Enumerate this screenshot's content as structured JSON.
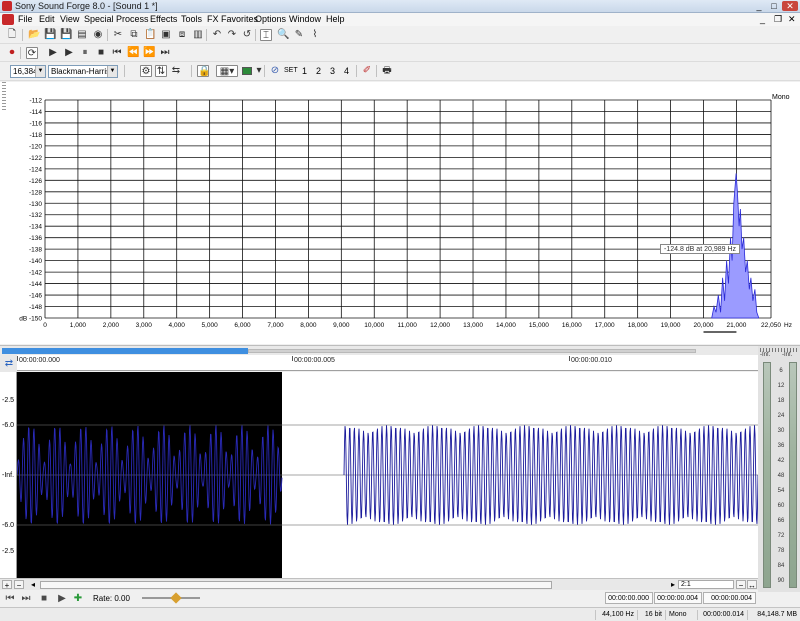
{
  "window": {
    "title": "Sony Sound Forge 8.0 - [Sound 1 *]",
    "min_glyph": "_",
    "max_glyph": "□",
    "close_glyph": "✕"
  },
  "menu": [
    "File",
    "Edit",
    "View",
    "Special",
    "Process",
    "Effects",
    "Tools",
    "FX Favorites",
    "Options",
    "Window",
    "Help"
  ],
  "mdi_controls": {
    "min": "_",
    "restore": "❐",
    "close": "✕"
  },
  "spectrum_toolbar": {
    "fft_size": "16,384",
    "window_function": "Blackman-Harris",
    "set_label": "SET",
    "snapshots": [
      "1",
      "2",
      "3",
      "4"
    ]
  },
  "spectrum": {
    "channel_label": "Mono",
    "y_unit": "dB",
    "y_ticks": [
      "-112",
      "-114",
      "-116",
      "-118",
      "-120",
      "-122",
      "-124",
      "-126",
      "-128",
      "-130",
      "-132",
      "-134",
      "-136",
      "-138",
      "-140",
      "-142",
      "-144",
      "-146",
      "-148",
      "-150"
    ],
    "x_ticks": [
      "0",
      "1,000",
      "2,000",
      "3,000",
      "4,000",
      "5,000",
      "6,000",
      "7,000",
      "8,000",
      "9,000",
      "10,000",
      "11,000",
      "12,000",
      "13,000",
      "14,000",
      "15,000",
      "16,000",
      "17,000",
      "18,000",
      "19,000",
      "20,000",
      "21,000",
      "22,050"
    ],
    "x_unit": "Hz",
    "tooltip": "-124.8 dB at 20,989 Hz",
    "fill_color": "#9b9bff",
    "stroke_color": "#2a2ad8"
  },
  "ruler": {
    "labels": [
      "00:00:00.000",
      "00:00:00.005",
      "00:00:00.010"
    ]
  },
  "waveform": {
    "y_labels": [
      "-2.5",
      "-6.0",
      "-Inf.",
      "-6.0",
      "-2.5"
    ],
    "wave_color": "#1c1c9c",
    "selection_color": "#000000"
  },
  "meters": {
    "left_inf": "-Inf.",
    "right_inf": "-Inf.",
    "scale": [
      "6",
      "12",
      "18",
      "24",
      "30",
      "36",
      "42",
      "48",
      "54",
      "60",
      "66",
      "72",
      "78",
      "84",
      "90"
    ]
  },
  "scroll": {
    "zoom_ratio": "2:1"
  },
  "transport": {
    "rate": "Rate: 0.00",
    "selection_start": "00:00:00.000",
    "selection_end": "00:00:00.004",
    "selection_length": "00:00:00.004"
  },
  "status": {
    "sample_rate": "44,100 Hz",
    "bit_depth": "16 bit",
    "channels": "Mono",
    "length": "00:00:00.014",
    "free_space": "84,148.7 MB"
  }
}
